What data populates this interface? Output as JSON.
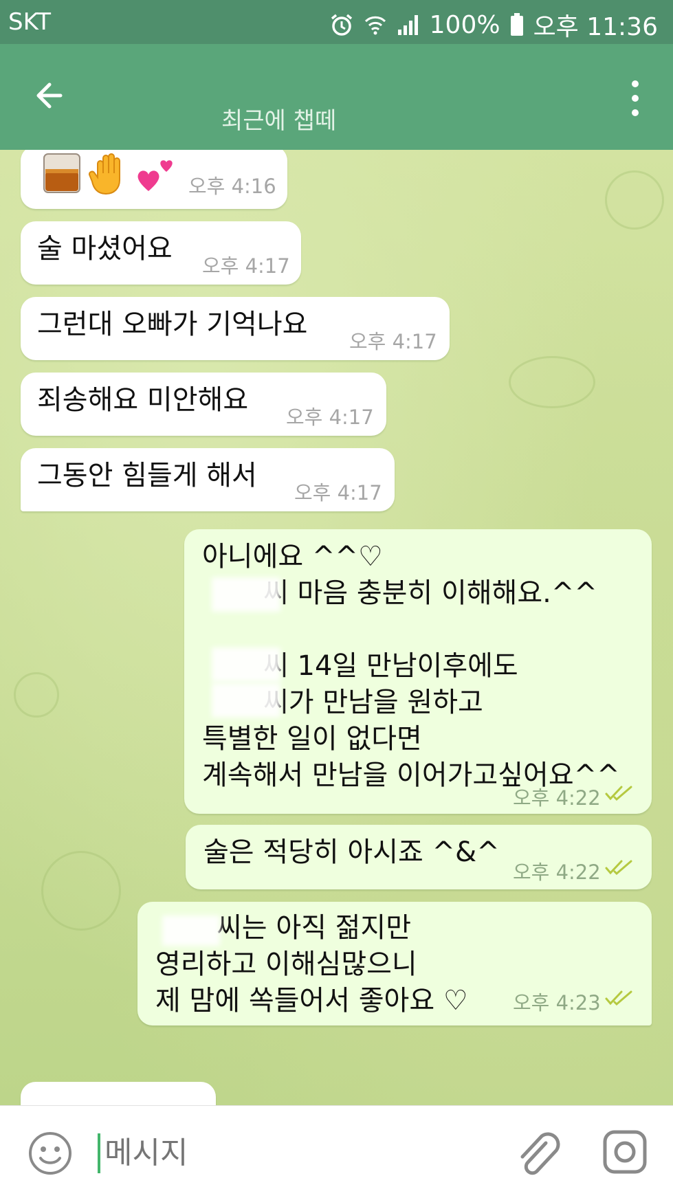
{
  "status_bar": {
    "carrier": "SKT",
    "battery": "100%",
    "time": "오후 11:36"
  },
  "header": {
    "title": "최근에 챕떼"
  },
  "messages": [
    {
      "direction": "in",
      "text": "",
      "time": "오후 4:16",
      "emojis": [
        "🥃",
        "🖐",
        "💕"
      ]
    },
    {
      "direction": "in",
      "text": "술 마셨어요",
      "time": "오후 4:17"
    },
    {
      "direction": "in",
      "text": "그런대 오빠가 기억나요",
      "time": "오후 4:17"
    },
    {
      "direction": "in",
      "text": "죄송해요 미안해요",
      "time": "오후 4:17"
    },
    {
      "direction": "in",
      "text": "그동안 힘들게 해서",
      "time": "오후 4:17"
    },
    {
      "direction": "out",
      "text": "아니에요 ^^♡\n       씨 마음 충분히 이해해요.^^\n\n       씨 14일 만남이후에도\n       씨가 만남을 원하고\n특별한 일이 없다면\n계속해서 만남을 이어가고싶어요^^",
      "time": "오후 4:22"
    },
    {
      "direction": "out",
      "text": "술은 적당히 아시죠 ^&^",
      "time": "오후 4:22"
    },
    {
      "direction": "out",
      "text": "       씨는 아직 젊지만\n영리하고 이해심많으니\n제 맘에 쏙들어서 좋아요 ♡",
      "time": "오후 4:23"
    }
  ],
  "input": {
    "placeholder": "메시지"
  },
  "colors": {
    "header": "#5aa67a",
    "status_bar": "#4f8f6c",
    "outgoing_bubble": "#efffde",
    "incoming_bubble": "#ffffff",
    "read_check": "#b5c940"
  },
  "icons": [
    "back-arrow-icon",
    "more-vert-icon",
    "alarm-icon",
    "wifi-icon",
    "signal-icon",
    "battery-icon",
    "emoji-icon",
    "attach-icon",
    "camera-icon",
    "double-check-icon"
  ]
}
